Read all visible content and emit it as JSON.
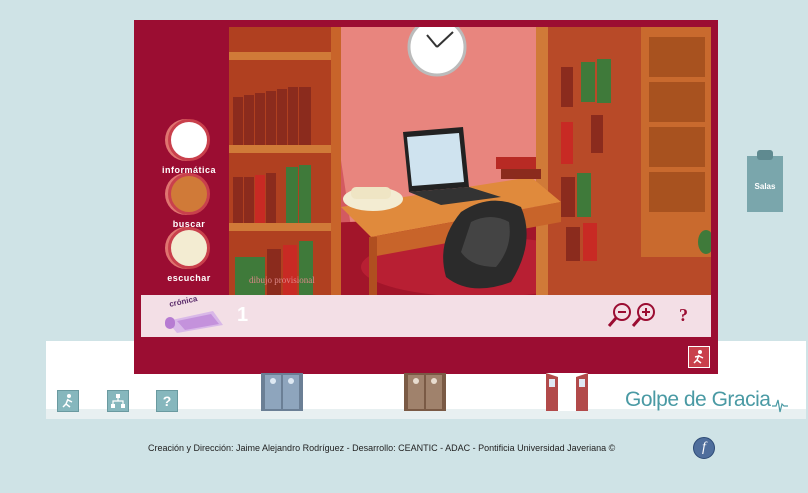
{
  "side_menu": {
    "items": [
      {
        "label": "informática"
      },
      {
        "label": "buscar"
      },
      {
        "label": "escuchar"
      }
    ]
  },
  "scene": {
    "watermark": "dibujo provisional"
  },
  "bottom_bar": {
    "chronicle_label": "crónica",
    "page_number": "1",
    "help": "?"
  },
  "salas": {
    "label": "Salas"
  },
  "toolbar": {
    "help": "?"
  },
  "logo": {
    "text": "Golpe de Gracia"
  },
  "footer": {
    "credits": "Creación y Dirección: Jaime Alejandro Rodríguez - Desarrollo: CEANTIC - ADAC - Pontificia Universidad Javeriana ©",
    "flash_glyph": "f"
  },
  "colors": {
    "frame": "#9b0d32",
    "background": "#cfe3e6",
    "logo": "#4a9aa4"
  }
}
